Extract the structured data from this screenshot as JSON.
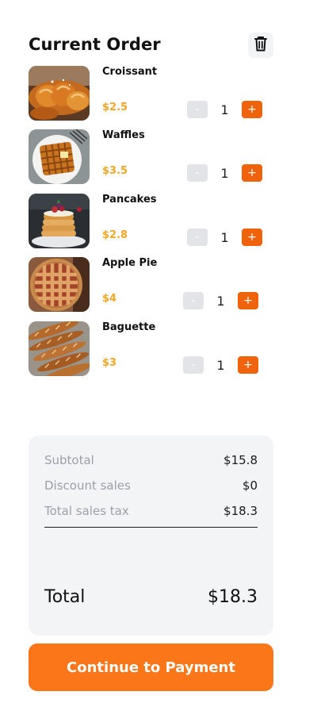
{
  "header": {
    "title": "Current Order",
    "trash_icon": "trash-icon"
  },
  "order": {
    "items": [
      {
        "name": "Croissant",
        "price": "$2.5",
        "quantity": "1",
        "minus_label": "-",
        "plus_label": "+",
        "image": "croissant-photo"
      },
      {
        "name": "Waffles",
        "price": "$3.5",
        "quantity": "1",
        "minus_label": "-",
        "plus_label": "+",
        "image": "waffles-photo"
      },
      {
        "name": "Pancakes",
        "price": "$2.8",
        "quantity": "1",
        "minus_label": "-",
        "plus_label": "+",
        "image": "pancakes-photo"
      },
      {
        "name": "Apple Pie",
        "price": "$4",
        "quantity": "1",
        "minus_label": "-",
        "plus_label": "+",
        "image": "apple-pie-photo"
      },
      {
        "name": "Baguette",
        "price": "$3",
        "quantity": "1",
        "minus_label": "-",
        "plus_label": "+",
        "image": "baguette-photo"
      }
    ]
  },
  "summary": {
    "subtotal_label": "Subtotal",
    "subtotal_value": "$15.8",
    "discount_label": "Discount sales",
    "discount_value": "$0",
    "tax_label": "Total sales tax",
    "tax_value": "$18.3",
    "total_label": "Total",
    "total_value": "$18.3"
  },
  "actions": {
    "pay_label": "Continue to Payment"
  },
  "colors": {
    "accent": "#fa7619",
    "plus_button": "#f0630d",
    "price": "#f5a623",
    "summary_bg": "#f3f4f6",
    "minus_button": "#e2e4e8"
  }
}
